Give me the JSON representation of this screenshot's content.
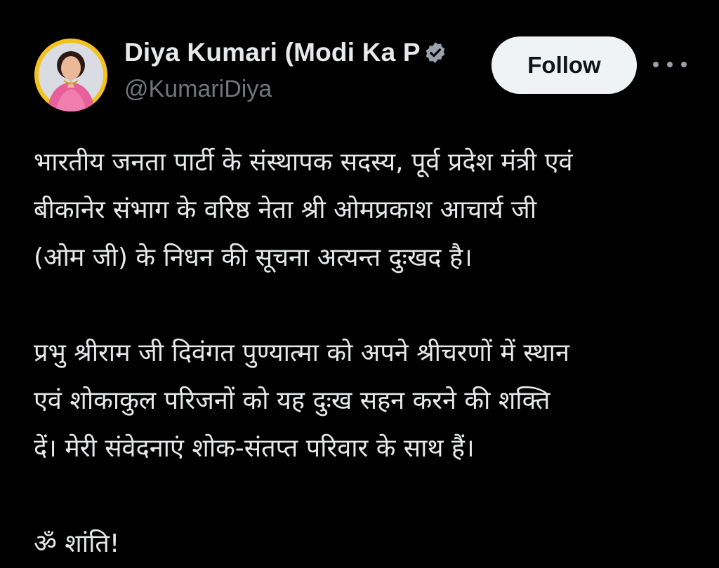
{
  "tweet": {
    "author": {
      "display_name": "Diya Kumari (Modi Ka P",
      "handle": "@KumariDiya",
      "verified_icon": "verified-badge-icon"
    },
    "follow_label": "Follow",
    "more_icon": "more-options-icon",
    "text_lines": [
      "भारतीय जनता पार्टी के संस्थापक सदस्य, पूर्व प्रदेश मंत्री एवं",
      "बीकानेर संभाग के वरिष्ठ नेता श्री ओमप्रकाश आचार्य जी",
      "(ओम जी) के निधन की सूचना अत्यन्त दुःखद है।",
      "प्रभु श्रीराम जी दिवंगत पुण्यात्मा को अपने श्रीचरणों में स्थान",
      "एवं शोकाकुल परिजनों को यह दुःख सहन करने की शक्ति",
      "दें। मेरी संवेदनाएं शोक-संतप्त परिवार के साथ हैं।",
      "ॐ शांति!"
    ]
  },
  "colors": {
    "background": "#000000",
    "text_primary": "#e7e9ea",
    "text_secondary": "#71767b",
    "follow_bg": "#eff3f4",
    "avatar_ring": "#f2c21e"
  }
}
